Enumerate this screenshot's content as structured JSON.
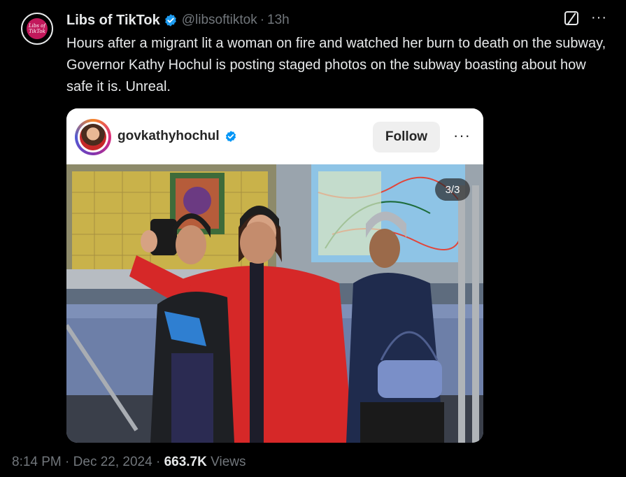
{
  "tweet": {
    "author": {
      "display_name": "Libs of TikTok",
      "handle": "@libsoftiktok",
      "avatar_text": "Libs of TikTok"
    },
    "separator": "·",
    "relative_time": "13h",
    "text": "Hours after a migrant lit a woman on fire and watched her burn to death on the subway, Governor Kathy Hochul is posting staged photos on the subway boasting about how safe it is. Unreal.",
    "more_icon": "···",
    "grok_icon": "grok-icon"
  },
  "embedded_post": {
    "username": "govkathyhochul",
    "follow_label": "Follow",
    "more_icon": "···",
    "photo_counter": "3/3"
  },
  "footer": {
    "time": "8:14 PM",
    "date": "Dec 22, 2024",
    "separator": "·",
    "views_count": "663.7K",
    "views_label": "Views"
  },
  "colors": {
    "background": "#000000",
    "text": "#e7e9ea",
    "muted": "#71767b",
    "verified": "#1d9bf0",
    "coat_red": "#d62828"
  }
}
